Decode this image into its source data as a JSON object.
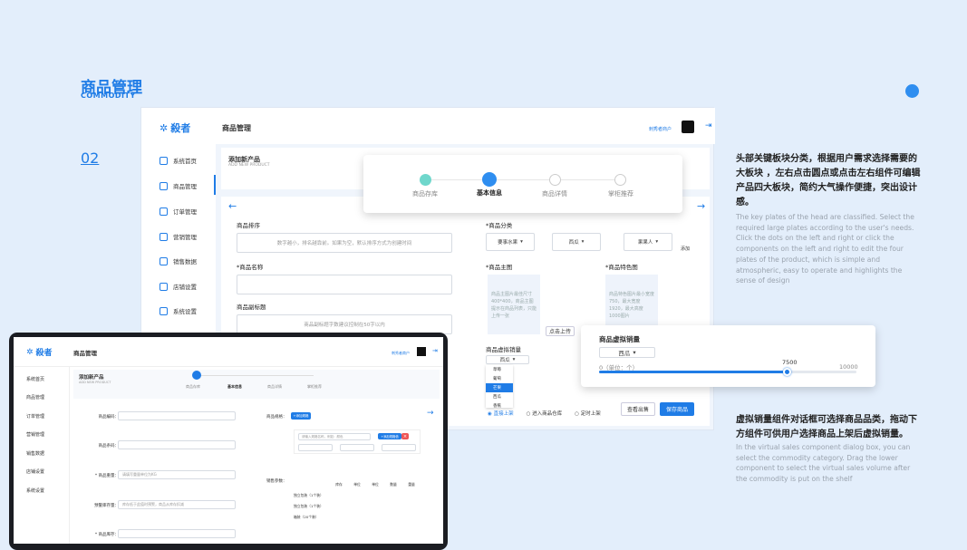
{
  "page": {
    "title_cn": "商品管理",
    "title_en": "COMMODITY",
    "number": "02"
  },
  "text1": {
    "cn": "头部关键板块分类，根据用户需求选择需要的大板块 ，左右点击圆点或点击左右组件可编辑产品四大板块，简约大气操作便捷，突出设计感。",
    "en": "The key plates of the head are classified. Select the required large plates according to the user's needs. Click the dots on the left and right or click the components on the left and right to edit the four plates of the product, which is simple and atmospheric, easy to operate and highlights the sense of design"
  },
  "text2": {
    "cn": "虚拟销量组件对话框可选择商品品类，拖动下方组件可供用户选择商品上架后虚拟销量。",
    "en": "In the virtual sales component dialog box, you can select the commodity category. Drag the lower component to select the virtual sales volume after the commodity is put on the shelf"
  },
  "app": {
    "brand": "殺者",
    "brand_sub": "SHAZHE",
    "header_title": "商品管理",
    "user": "刺秀者商户",
    "nav": [
      "系统首页",
      "商品管理",
      "订单管理",
      "营销管理",
      "销售数据",
      "店铺设置",
      "系统设置"
    ],
    "add_title": "添加新产品",
    "add_sub": "ADD NEW PRODUCT"
  },
  "steps": [
    "商品存库",
    "基本信息",
    "商品详情",
    "掌柜推荐"
  ],
  "form": {
    "sort_label": "商品排序",
    "sort_ph": "数字越小，排名越靠前。如果为空，默认排序方式为创建时间",
    "name_label": "*商品名称",
    "subtitle_label": "商品副标题",
    "subtitle_ph": "商品副标题字数建议控制在50字以内",
    "cat_label": "*商品分类",
    "cat_opts": [
      "要事水果",
      "西瓜",
      "果果人"
    ],
    "add": "添加",
    "main_img": "*商品主图",
    "main_img_hint": "商品主图片最佳尺寸400*400，商品主图提示在商品列表，只能上传一张",
    "feat_img": "*商品特色图",
    "feat_img_hint": "商品特色图片最小宽度750，最大宽度1920，最大高度1000图片",
    "upload": "点击上传",
    "sales_label": "商品虚拟销量",
    "sales_sel": "西瓜",
    "dropdown": [
      "草莓",
      "葡萄",
      "芒果",
      "西瓜",
      "香蕉"
    ],
    "dropdown_active": "芒果",
    "radio": [
      "直接上架",
      "进入商品仓库",
      "定时上架"
    ],
    "preview": "查看出售",
    "save": "保存商品"
  },
  "slider": {
    "title": "商品虚拟销量",
    "select": "西瓜",
    "min": "0（单位：个）",
    "value": "7500",
    "max": "10000",
    "fraction": 0.73
  },
  "tablet": {
    "step_active": "基本信息",
    "left_fields": [
      "商品编码：",
      "商品条码：",
      "* 商品重量：",
      "预警库存量：",
      "* 商品库存："
    ],
    "weight_ph": "请填写重量单位为KG",
    "stock_ph": "库存低于此值时预警，商品从库存扣减",
    "spec_label": "商品规格：",
    "spec_btn": "+添加规格",
    "spec_ph": "请输入规格名称，例如：颜色",
    "spec_btn2": "+添加规格值",
    "param_label": "销售参数：",
    "param_cols": [
      "库存",
      "单位",
      "单位",
      "数量",
      "重量"
    ],
    "param_rows": [
      "独立包装（1个装）",
      "独立包装（1个装）",
      "箱装（20个装）"
    ]
  }
}
